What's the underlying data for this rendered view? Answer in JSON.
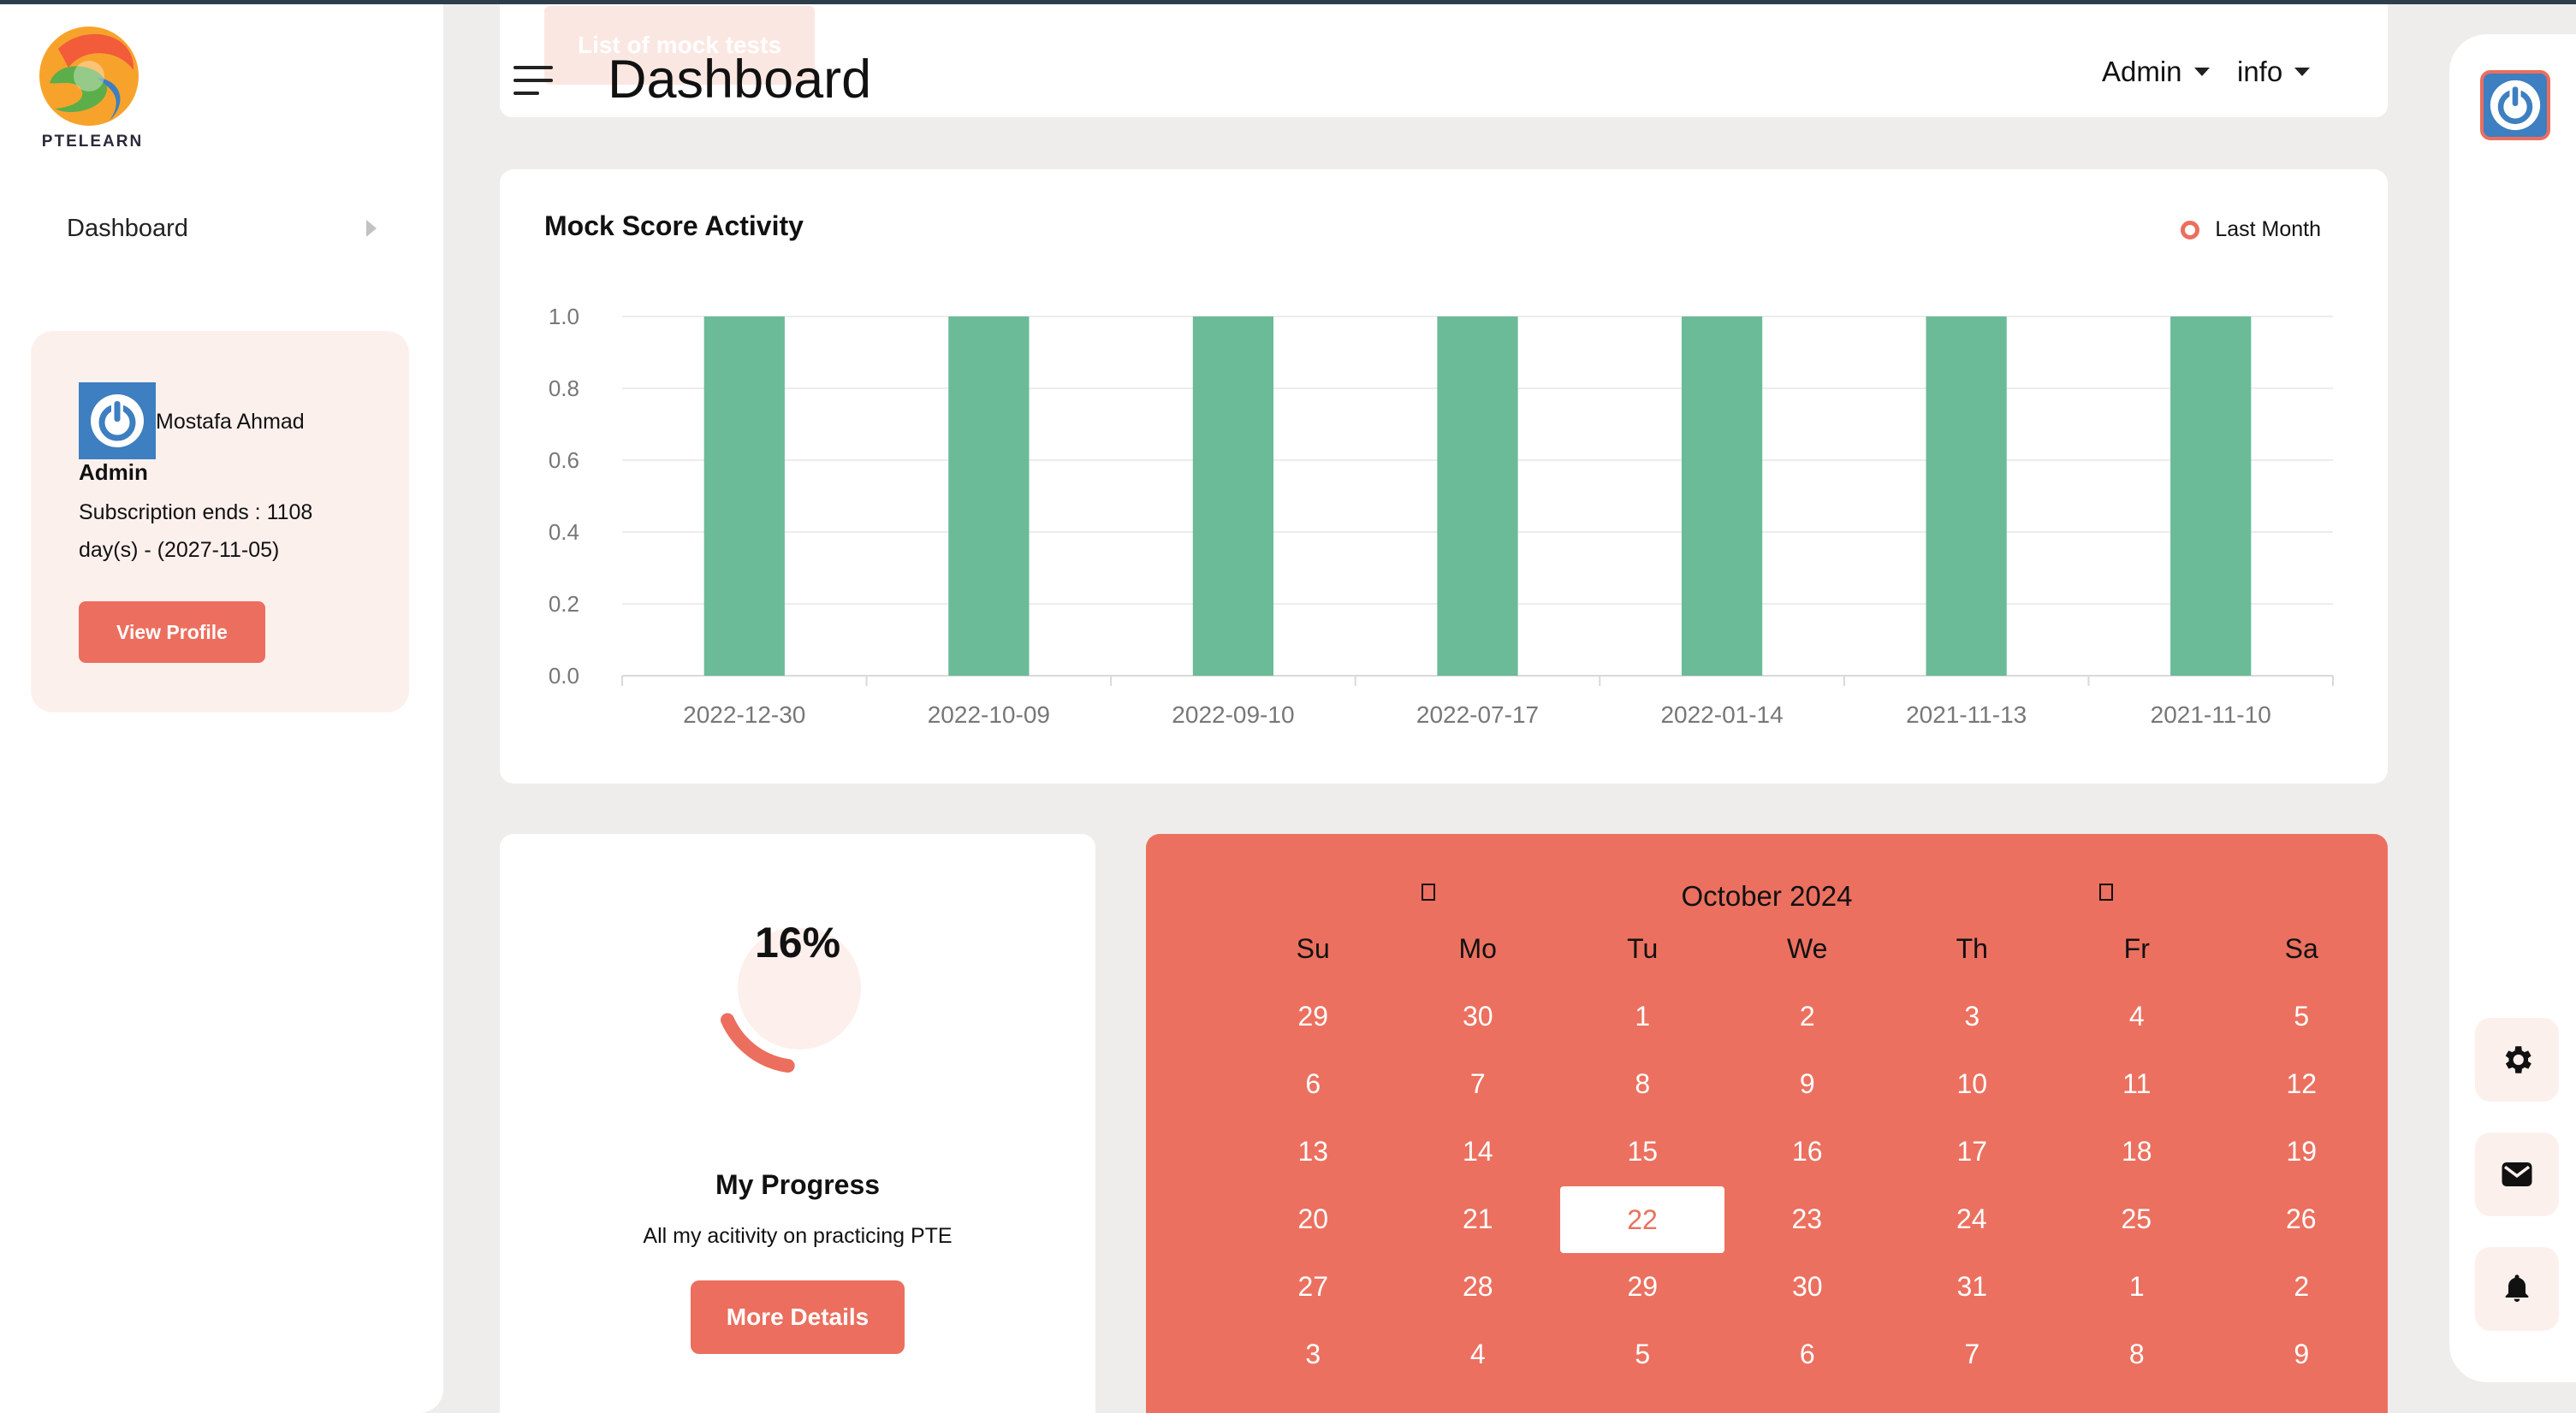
{
  "app": {
    "logo_text": "PTELEARN"
  },
  "sidebar": {
    "items": [
      {
        "label": "Dashboard"
      }
    ],
    "profile": {
      "name": "Mostafa Ahmad",
      "role": "Admin",
      "subscription": "Subscription ends : 1108 day(s) - (2027-11-05)",
      "button_label": "View Profile"
    }
  },
  "header": {
    "ghost_button": "List of mock tests",
    "title": "Dashboard",
    "menus": [
      {
        "label": "Admin"
      },
      {
        "label": "info"
      }
    ]
  },
  "rail": {
    "icons": [
      "power-icon",
      "gear-icon",
      "mail-icon",
      "bell-icon"
    ]
  },
  "colors": {
    "accent": "#ec6e5e",
    "bar": "#6bba98",
    "avatar_blue": "#3d7fc0"
  },
  "chart_data": {
    "type": "bar",
    "title": "Mock Score Activity",
    "legend": "Last Month",
    "categories": [
      "2022-12-30",
      "2022-10-09",
      "2022-09-10",
      "2022-07-17",
      "2022-01-14",
      "2021-11-13",
      "2021-11-10"
    ],
    "values": [
      1,
      1,
      1,
      1,
      1,
      1,
      1
    ],
    "yticks": [
      "0.0",
      "0.2",
      "0.4",
      "0.6",
      "0.8",
      "1.0"
    ],
    "ylim": [
      0,
      1
    ],
    "grid": true,
    "legend_position": "top-right"
  },
  "progress": {
    "percent": 16,
    "percent_label": "16%",
    "title": "My Progress",
    "subtitle": "All my acitivity on practicing PTE",
    "button_label": "More Details"
  },
  "calendar": {
    "month_label": "October 2024",
    "weekdays": [
      "Su",
      "Mo",
      "Tu",
      "We",
      "Th",
      "Fr",
      "Sa"
    ],
    "weeks": [
      [
        "29",
        "30",
        "1",
        "2",
        "3",
        "4",
        "5"
      ],
      [
        "6",
        "7",
        "8",
        "9",
        "10",
        "11",
        "12"
      ],
      [
        "13",
        "14",
        "15",
        "16",
        "17",
        "18",
        "19"
      ],
      [
        "20",
        "21",
        "22",
        "23",
        "24",
        "25",
        "26"
      ],
      [
        "27",
        "28",
        "29",
        "30",
        "31",
        "1",
        "2"
      ],
      [
        "3",
        "4",
        "5",
        "6",
        "7",
        "8",
        "9"
      ]
    ],
    "today": "22"
  }
}
